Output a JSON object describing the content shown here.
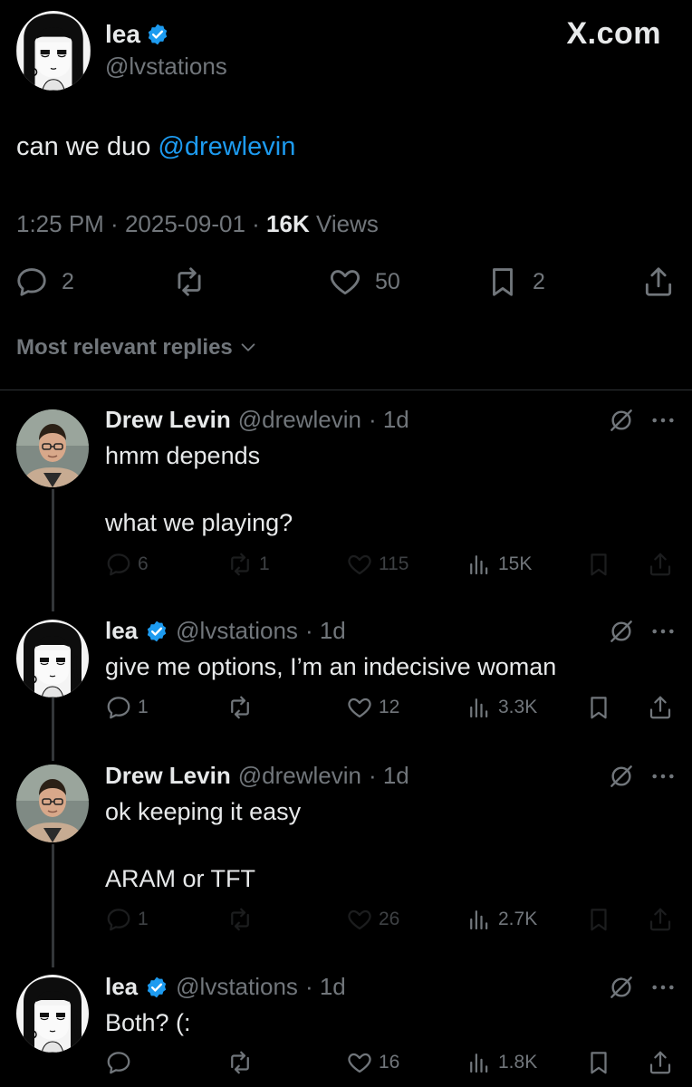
{
  "site": {
    "label": "X.com"
  },
  "post": {
    "name": "lea",
    "handle": "@lvstations",
    "text_prefix": "can we duo ",
    "mention": "@drewlevin",
    "time": "1:25 PM",
    "sep1": " · ",
    "date": "2025-09-01",
    "sep2": " · ",
    "views_count": "16K",
    "views_label": " Views",
    "replies": "2",
    "likes": "50",
    "bookmarks": "2"
  },
  "sort": {
    "label": "Most relevant replies"
  },
  "replies": [
    {
      "name": "Drew Levin",
      "handle": "@drewlevin",
      "time": "· 1d",
      "line1": "hmm depends",
      "line2": "what we playing?",
      "replies": "6",
      "reposts": "1",
      "likes": "115",
      "views": "15K"
    },
    {
      "name": "lea",
      "handle": "@lvstations",
      "time": "· 1d",
      "line1": "give me options, I’m an indecisive woman",
      "replies": "1",
      "likes": "12",
      "views": "3.3K"
    },
    {
      "name": "Drew Levin",
      "handle": "@drewlevin",
      "time": "· 1d",
      "line1": "ok keeping it easy",
      "line2": "ARAM or TFT",
      "replies": "1",
      "likes": "26",
      "views": "2.7K"
    },
    {
      "name": "lea",
      "handle": "@lvstations",
      "time": "· 1d",
      "line1": "Both? (:",
      "likes": "16",
      "views": "1.8K"
    }
  ],
  "colors": {
    "background": "#000000",
    "text": "#e7e9ea",
    "muted": "#71767b",
    "accent": "#1d9bf0"
  },
  "icons": [
    "reply-icon",
    "repost-icon",
    "like-icon",
    "bookmark-icon",
    "share-icon",
    "views-icon",
    "verified-icon",
    "grok-icon",
    "more-icon",
    "chevron-down-icon"
  ]
}
